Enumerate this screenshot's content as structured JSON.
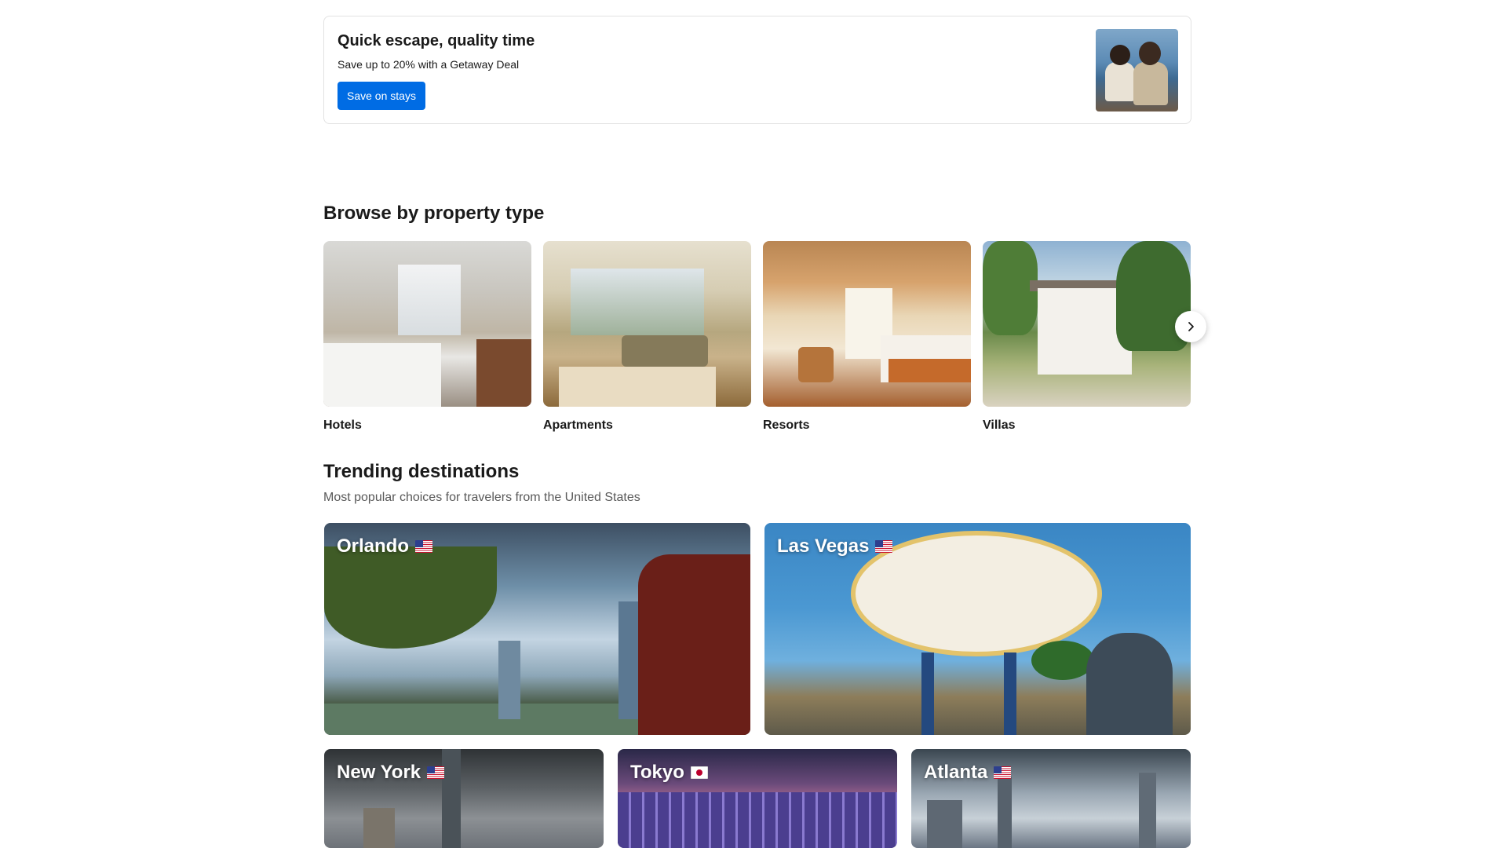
{
  "promo": {
    "title": "Quick escape, quality time",
    "subtitle": "Save up to 20% with a Getaway Deal",
    "button_label": "Save on stays"
  },
  "property_types": {
    "heading": "Browse by property type",
    "items": [
      {
        "label": "Hotels"
      },
      {
        "label": "Apartments"
      },
      {
        "label": "Resorts"
      },
      {
        "label": "Villas"
      }
    ],
    "next_icon": "chevron-right-icon"
  },
  "trending": {
    "heading": "Trending destinations",
    "subtitle": "Most popular choices for travelers from the United States",
    "destinations": [
      {
        "name": "Orlando",
        "flag": "us-flag-icon"
      },
      {
        "name": "Las Vegas",
        "flag": "us-flag-icon"
      },
      {
        "name": "New York",
        "flag": "us-flag-icon"
      },
      {
        "name": "Tokyo",
        "flag": "jp-flag-icon"
      },
      {
        "name": "Atlanta",
        "flag": "us-flag-icon"
      }
    ]
  },
  "colors": {
    "accent": "#006ce4",
    "text": "#1a1a1a",
    "muted": "#595959",
    "border": "#e2e2e2"
  }
}
